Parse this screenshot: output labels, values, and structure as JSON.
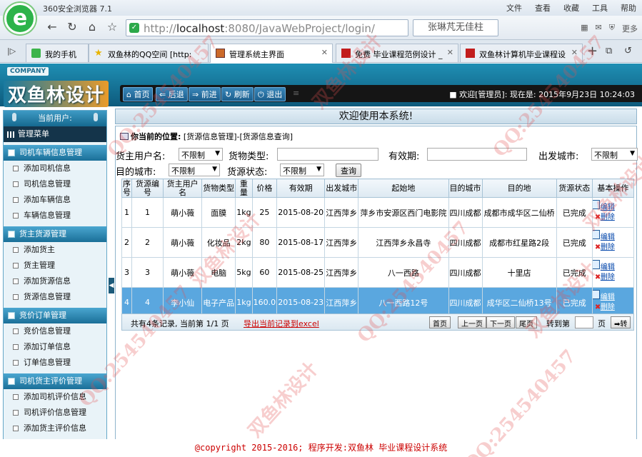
{
  "browser": {
    "app_title": "360安全浏览器 7.1",
    "menu": [
      "文件",
      "查看",
      "收藏",
      "工具",
      "帮助"
    ],
    "url_prefix": "http://",
    "url_host": "localhost",
    "url_rest": ":8080/JavaWebProject/login/",
    "search_text": "张琳芃无佳柱",
    "more_label": "更多",
    "tabs": [
      {
        "label": "我的手机",
        "active": false
      },
      {
        "label": "双鱼林的QQ空间 [http:",
        "active": false
      },
      {
        "label": "管理系统主界面",
        "active": true
      },
      {
        "label": "免费 毕业课程范例设计 _",
        "active": false
      },
      {
        "label": "双鱼林计算机毕业课程设",
        "active": false
      }
    ]
  },
  "header": {
    "company": "COMPANY",
    "brand": "双鱼林设计",
    "nav": [
      "首页",
      "后退",
      "前进",
      "刷新",
      "退出"
    ],
    "welcome": "欢迎[管理员]: 现在是: 2015年9月23日 10:24:03"
  },
  "sidebar": {
    "user_label": "当前用户:",
    "main_menu": "管理菜单",
    "groups": [
      {
        "title": "司机车辆信息管理",
        "items": [
          "添加司机信息",
          "司机信息管理",
          "添加车辆信息",
          "车辆信息管理"
        ]
      },
      {
        "title": "货主货源管理",
        "items": [
          "添加货主",
          "货主管理",
          "添加货源信息",
          "货源信息管理"
        ]
      },
      {
        "title": "竞价订单管理",
        "items": [
          "竞价信息管理",
          "添加订单信息",
          "订单信息管理"
        ]
      },
      {
        "title": "司机货主评价管理",
        "items": [
          "添加司机评价信息",
          "司机评价信息管理",
          "添加货主评价信息"
        ]
      }
    ]
  },
  "main": {
    "welcome_bar": "欢迎使用本系统!",
    "location_label": "你当前的位置:",
    "location_path": "[货源信息管理]-[货源信息查询]",
    "filters": {
      "owner_label": "货主用户名:",
      "owner_value": "不限制",
      "type_label": "货物类型:",
      "valid_label": "有效期:",
      "from_city_label": "出发城市:",
      "from_city_value": "不限制",
      "dest_city_label": "目的城市:",
      "dest_city_value": "不限制",
      "state_label": "货源状态:",
      "state_value": "不限制",
      "query_button": "查询"
    },
    "table": {
      "headers": [
        "序号",
        "货源编号",
        "货主用户名",
        "货物类型",
        "重量",
        "价格",
        "有效期",
        "出发城市",
        "起始地",
        "目的城市",
        "目的地",
        "货源状态",
        "基本操作"
      ],
      "rows": [
        [
          "1",
          "1",
          "萌小薇",
          "面膜",
          "1kg",
          "25",
          "2015-08-20",
          "江西萍乡",
          "萍乡市安源区西门电影院",
          "四川成都",
          "成都市成华区二仙桥",
          "已完成"
        ],
        [
          "2",
          "2",
          "萌小薇",
          "化妆品",
          "2kg",
          "80",
          "2015-08-17",
          "江西萍乡",
          "江西萍乡永昌寺",
          "四川成都",
          "成都市红星路2段",
          "已完成"
        ],
        [
          "3",
          "3",
          "萌小薇",
          "电脑",
          "5kg",
          "60",
          "2015-08-25",
          "江西萍乡",
          "八一西路",
          "四川成都",
          "十里店",
          "已完成"
        ],
        [
          "4",
          "4",
          "李小仙",
          "电子产品",
          "1kg",
          "160.0",
          "2015-08-23",
          "江西萍乡",
          "八一西路12号",
          "四川成都",
          "成华区二仙桥13号",
          "已完成"
        ]
      ],
      "selected_row": 3,
      "op_edit": "编辑",
      "op_delete": "删除"
    },
    "pager": {
      "info": "共有4条记录, 当前第 1/1 页",
      "export": "导出当前记录到excel",
      "first": "首页",
      "prev": "上一页",
      "next": "下一页",
      "last": "尾页",
      "goto_label": "转到第",
      "page_unit": "页",
      "jump": "转"
    }
  },
  "footer": "@copyright 2015-2016; 程序开发:双鱼林 毕业课程设计系统",
  "watermark": [
    "QQ:254540457",
    "双鱼林设计"
  ],
  "colors": {
    "header": "#1a7aa0",
    "selected_row": "#5aa7df",
    "footer_text": "#cc0000"
  }
}
